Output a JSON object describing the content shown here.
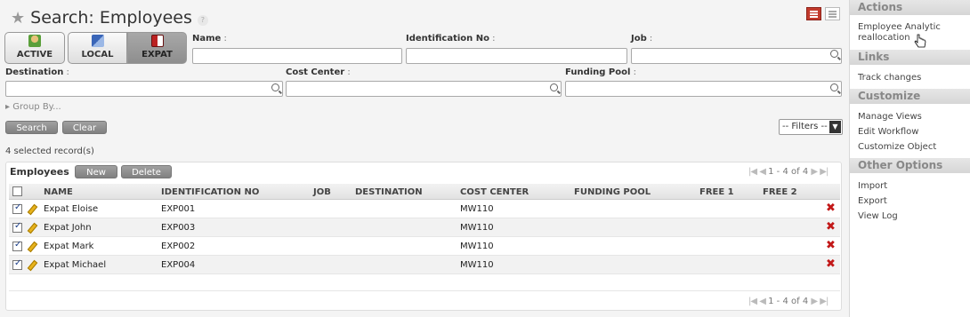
{
  "page": {
    "title": "Search: Employees",
    "help": "?"
  },
  "filter_buttons": {
    "active": "ACTIVE",
    "local": "LOCAL",
    "expat": "EXPAT"
  },
  "fields": {
    "name": "Name",
    "identification_no": "Identification No",
    "job": "Job",
    "destination": "Destination",
    "cost_center": "Cost Center",
    "funding_pool": "Funding Pool"
  },
  "group_by": "▸ Group By...",
  "actions": {
    "search": "Search",
    "clear": "Clear",
    "filters": "-- Filters --"
  },
  "selected_records": "4 selected record(s)",
  "grid": {
    "title": "Employees",
    "new": "New",
    "delete": "Delete",
    "pager": "1 - 4 of 4",
    "columns": [
      "NAME",
      "IDENTIFICATION NO",
      "JOB",
      "DESTINATION",
      "COST CENTER",
      "FUNDING POOL",
      "FREE 1",
      "FREE 2"
    ],
    "rows": [
      {
        "name": "Expat Eloise",
        "id": "EXP001",
        "cost_center": "MW110"
      },
      {
        "name": "Expat John",
        "id": "EXP003",
        "cost_center": "MW110"
      },
      {
        "name": "Expat Mark",
        "id": "EXP002",
        "cost_center": "MW110"
      },
      {
        "name": "Expat Michael",
        "id": "EXP004",
        "cost_center": "MW110"
      }
    ]
  },
  "sidebar": {
    "actions": {
      "title": "Actions",
      "items": [
        "Employee Analytic",
        "reallocation"
      ]
    },
    "links": {
      "title": "Links",
      "items": [
        "Track changes"
      ]
    },
    "customize": {
      "title": "Customize",
      "items": [
        "Manage Views",
        "Edit Workflow",
        "Customize Object"
      ]
    },
    "other": {
      "title": "Other Options",
      "items": [
        "Import",
        "Export",
        "View Log"
      ]
    }
  },
  "colors": {
    "accent_red": "#c23a2c",
    "delete_red": "#c21818",
    "checkbox_blue": "#1c3f8a"
  }
}
